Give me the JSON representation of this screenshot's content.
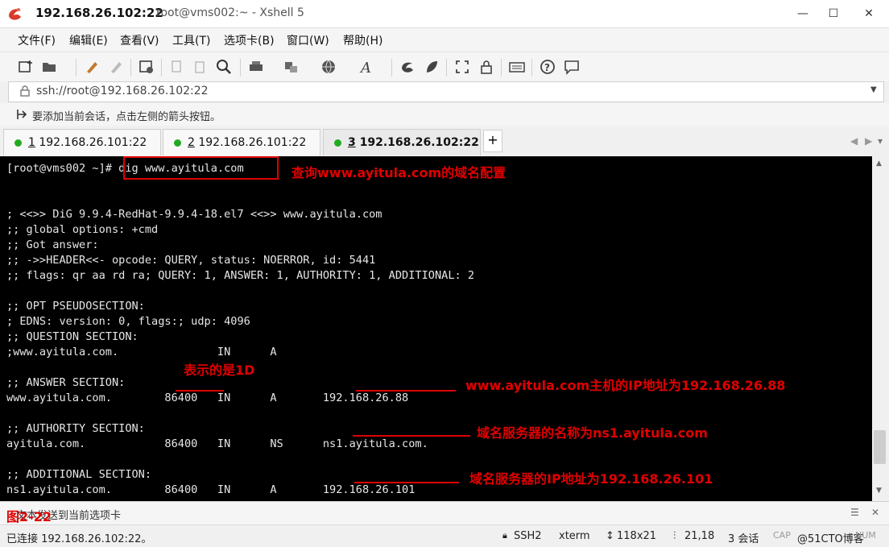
{
  "window": {
    "host": "192.168.26.102:22",
    "subtitle": "root@vms002:~ - Xshell 5",
    "minimize": "—",
    "maximize": "☐",
    "close": "✕"
  },
  "menu": [
    "文件(F)",
    "编辑(E)",
    "查看(V)",
    "工具(T)",
    "选项卡(B)",
    "窗口(W)",
    "帮助(H)"
  ],
  "address": {
    "url": "ssh://root@192.168.26.102:22"
  },
  "hint": "要添加当前会话，点击左侧的箭头按钮。",
  "tabs": [
    {
      "num": "1",
      "label": " 192.168.26.101:22"
    },
    {
      "num": "2",
      "label": " 192.168.26.101:22"
    },
    {
      "num": "3",
      "label": " 192.168.26.102:22"
    }
  ],
  "tab_add": "+",
  "terminal": {
    "prompt": "[root@vms002 ~]#",
    "command": " dig www.ayitula.com",
    "lines": [
      "",
      "",
      "; <<>> DiG 9.9.4-RedHat-9.9.4-18.el7 <<>> www.ayitula.com",
      ";; global options: +cmd",
      ";; Got answer:",
      ";; ->>HEADER<<- opcode: QUERY, status: NOERROR, id: 5441",
      ";; flags: qr aa rd ra; QUERY: 1, ANSWER: 1, AUTHORITY: 1, ADDITIONAL: 2",
      "",
      ";; OPT PSEUDOSECTION:",
      "; EDNS: version: 0, flags:; udp: 4096",
      ";; QUESTION SECTION:",
      ";www.ayitula.com.               IN      A",
      "",
      ";; ANSWER SECTION:",
      "www.ayitula.com.        86400   IN      A       192.168.26.88",
      "",
      ";; AUTHORITY SECTION:",
      "ayitula.com.            86400   IN      NS      ns1.ayitula.com.",
      "",
      ";; ADDITIONAL SECTION:",
      "ns1.ayitula.com.        86400   IN      A       192.168.26.101"
    ]
  },
  "annotations": {
    "query": "查询www.ayitula.com的域名配置",
    "ttl": "表示的是1D",
    "answer": "www.ayitula.com主机的IP地址为192.168.26.88",
    "ns": "域名服务器的名称为ns1.ayitula.com",
    "ns_ip": "域名服务器的IP地址为192.168.26.101",
    "figure": "图2-22"
  },
  "input_bar": {
    "text": "文本发送到当前选项卡"
  },
  "status": {
    "connected": "已连接 192.168.26.102:22。",
    "protocol": "SSH2",
    "term": "xterm",
    "size": "118x21",
    "cursor": "21,18",
    "sessions": "3 会话",
    "caps": "CAP",
    "num": "NUM",
    "watermark": "@51CTO博客"
  }
}
